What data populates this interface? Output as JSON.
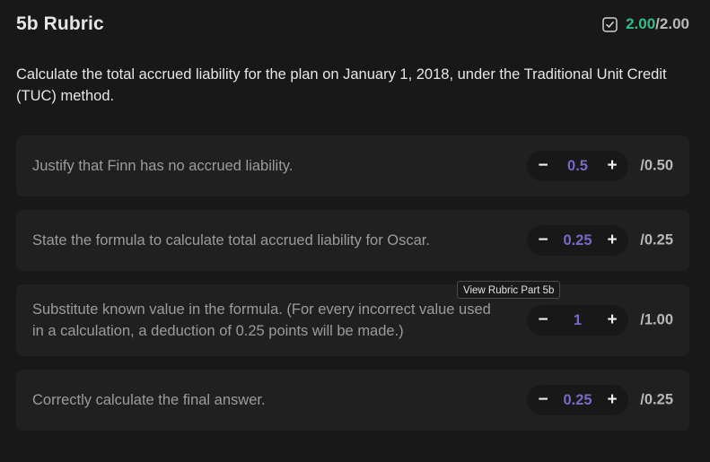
{
  "header": {
    "title": "5b Rubric",
    "score_earned": "2.00",
    "score_slash": "/",
    "score_total": "2.00"
  },
  "question": "Calculate the total accrued liability for the plan on January 1, 2018, under the Traditional Unit Credit (TUC) method.",
  "criteria": [
    {
      "text": "Justify that Finn has no accrued liability.",
      "minus": "−",
      "value": "0.5",
      "plus": "+",
      "max": "/0.50"
    },
    {
      "text": "State the formula to calculate total accrued liability for Oscar.",
      "minus": "−",
      "value": "0.25",
      "plus": "+",
      "max": "/0.25"
    },
    {
      "text": "Substitute known value in the formula. (For every incorrect value used in a calculation, a deduction of 0.25 points will be made.)",
      "minus": "−",
      "value": "1",
      "plus": "+",
      "max": "/1.00"
    },
    {
      "text": "Correctly calculate the final answer.",
      "minus": "−",
      "value": "0.25",
      "plus": "+",
      "max": "/0.25"
    }
  ],
  "tooltip": "View Rubric Part 5b",
  "icons": {
    "score": "checkbox-checked-icon"
  },
  "colors": {
    "background": "#181818",
    "card": "#202020",
    "score_green": "#2fbf86",
    "value_purple": "#7a68c4"
  }
}
